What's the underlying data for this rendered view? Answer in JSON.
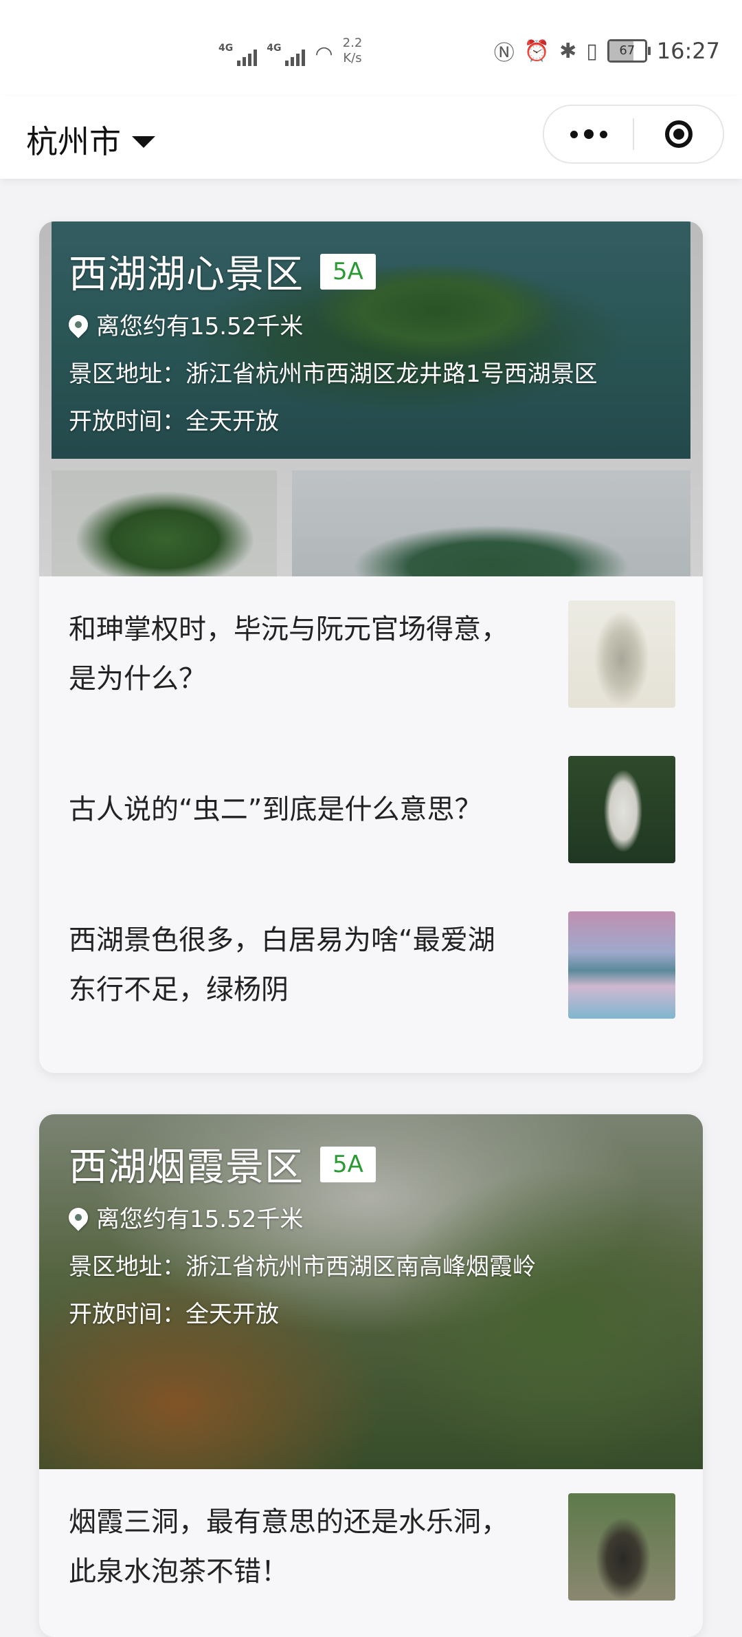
{
  "status_bar": {
    "network_1": "4G",
    "network_2": "4G",
    "speed_value": "2.2",
    "speed_unit": "K/s",
    "battery": "67",
    "time": "16:27",
    "icons": [
      "nfc-icon",
      "alarm-icon",
      "bluetooth-icon",
      "vibrate-icon"
    ]
  },
  "header": {
    "city": "杭州市"
  },
  "cards": [
    {
      "title": "西湖湖心景区",
      "badge": "5A",
      "distance": "离您约有15.52千米",
      "address": "景区地址：浙江省杭州市西湖区龙井路1号西湖景区",
      "hours": "开放时间：全天开放",
      "articles": [
        {
          "text": "和珅掌权时，毕沅与阮元官场得意，是为什么？"
        },
        {
          "text": "古人说的“虫二”到底是什么意思？"
        },
        {
          "text": "西湖景色很多，白居易为啥“最爱湖东行不足，绿杨阴"
        }
      ]
    },
    {
      "title": "西湖烟霞景区",
      "badge": "5A",
      "distance": "离您约有15.52千米",
      "address": "景区地址：浙江省杭州市西湖区南高峰烟霞岭",
      "hours": "开放时间：全天开放",
      "articles": [
        {
          "text": "烟霞三洞，最有意思的还是水乐洞，此泉水泡茶不错！"
        }
      ]
    }
  ]
}
